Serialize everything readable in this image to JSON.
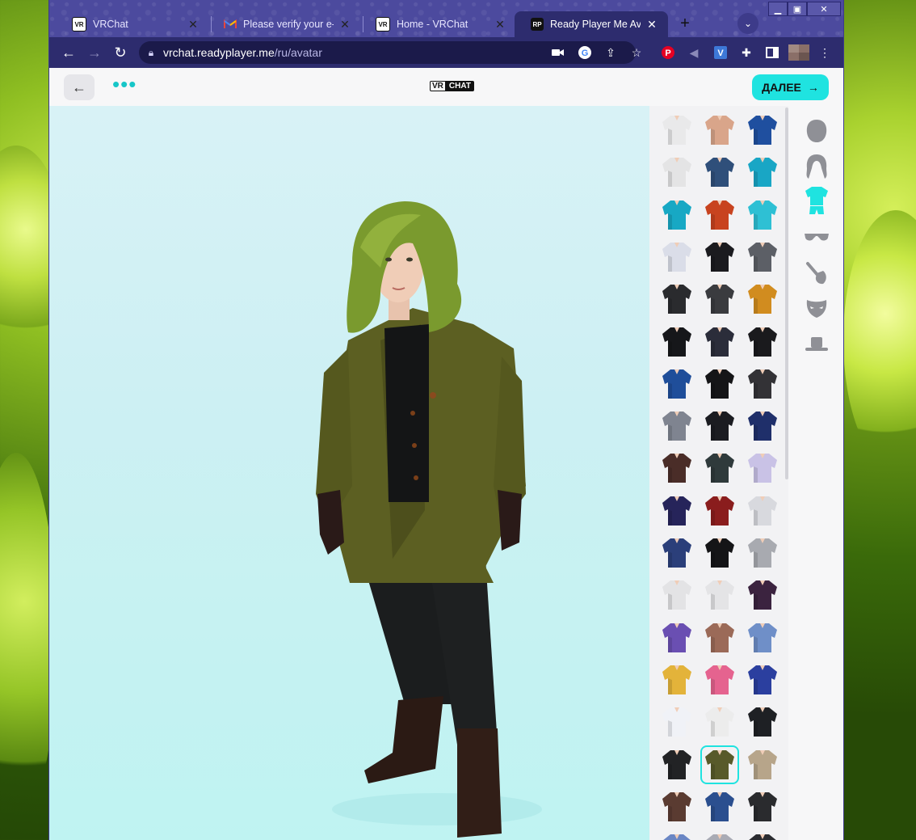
{
  "browser": {
    "tabs": [
      {
        "title": "VRChat",
        "icon": "vrchat-icon",
        "active": false
      },
      {
        "title": "Please verify your e-ma",
        "icon": "gmail-icon",
        "active": false
      },
      {
        "title": "Home - VRChat",
        "icon": "vrchat-icon",
        "active": false
      },
      {
        "title": "Ready Player Me Avata",
        "icon": "readyplayerme-icon",
        "active": true
      }
    ],
    "new_tab_label": "+",
    "address": {
      "host": "vrchat.readyplayer.me",
      "path": "/ru/avatar"
    }
  },
  "header": {
    "logo_vr": "VR",
    "logo_chat": "CHAT",
    "menu_label": "•••",
    "next_button_label": "ДАЛЕЕ"
  },
  "categories": [
    {
      "name": "face",
      "icon": "head-icon",
      "active": false
    },
    {
      "name": "hair",
      "icon": "hair-icon",
      "active": false
    },
    {
      "name": "outfit",
      "icon": "shirt-icon",
      "active": true
    },
    {
      "name": "glasses",
      "icon": "glasses-icon",
      "active": false
    },
    {
      "name": "makeup",
      "icon": "brush-icon",
      "active": false
    },
    {
      "name": "facewear",
      "icon": "mask-icon",
      "active": false
    },
    {
      "name": "headwear",
      "icon": "hat-icon",
      "active": false
    }
  ],
  "outfits": {
    "selected_index": 46,
    "colors": [
      "#e9e9ea",
      "#d9a58a",
      "#1f4f9f",
      "#e4e4e5",
      "#2f4f7a",
      "#19a6c5",
      "#17a8c4",
      "#c8431f",
      "#2ec0d4",
      "#dadde8",
      "#1b1b1f",
      "#5c5f66",
      "#2a2b2e",
      "#3a3b3f",
      "#d18c1f",
      "#16171a",
      "#2b2d3a",
      "#1a1a1d",
      "#1f4e9a",
      "#151517",
      "#333236",
      "#7f8490",
      "#1b1c21",
      "#1f2f6a",
      "#4a2d28",
      "#2f3a3b",
      "#c9c2e6",
      "#26245a",
      "#8a1d1d",
      "#d8d9de",
      "#2b3f7a",
      "#151517",
      "#a8aab0",
      "#e3e3e5",
      "#e4e4e6",
      "#3b233f",
      "#6a4fb2",
      "#9b6a58",
      "#6f8fc8",
      "#e3b33a",
      "#e5638f",
      "#2b3f9f",
      "#f0f2f7",
      "#ececec",
      "#1e2024",
      "#222325",
      "#585a2a",
      "#b7a58a",
      "#5a3b31",
      "#2b4f8f",
      "#2a2b2e",
      "#6a86c4",
      "#a9abb5",
      "#2a2b30"
    ]
  }
}
